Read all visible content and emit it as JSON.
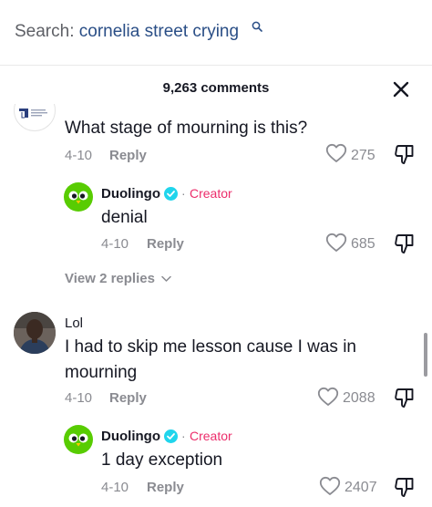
{
  "search": {
    "prefix": "Search: ",
    "query": "cornelia street crying"
  },
  "header": {
    "comment_count": "9,263 comments"
  },
  "comments": [
    {
      "username": "",
      "text": "What stage of mourning is this?",
      "date": "4-10",
      "reply_label": "Reply",
      "likes": "275",
      "view_replies": "View 2 replies",
      "replies": [
        {
          "username": "Duolingo",
          "verified": true,
          "separator": "·",
          "badge": "Creator",
          "text": "denial",
          "date": "4-10",
          "reply_label": "Reply",
          "likes": "685"
        }
      ]
    },
    {
      "username": "Lol",
      "text_line1": "I had to skip me lesson cause I was in",
      "text_line2": "mourning",
      "date": "4-10",
      "reply_label": "Reply",
      "likes": "2088",
      "replies": [
        {
          "username": "Duolingo",
          "verified": true,
          "separator": "·",
          "badge": "Creator",
          "text": "1 day exception",
          "date": "4-10",
          "reply_label": "Reply",
          "likes": "2407"
        }
      ]
    }
  ],
  "colors": {
    "query": "#2a4e86",
    "creator_badge": "#ec2d6b",
    "verified_badge": "#20d5ec",
    "muted": "#8a8b91",
    "duolingo_green": "#58cc02"
  },
  "icons": [
    "search-icon",
    "close-icon",
    "heart-icon",
    "dislike-icon",
    "verified-icon",
    "chevron-down-icon"
  ]
}
